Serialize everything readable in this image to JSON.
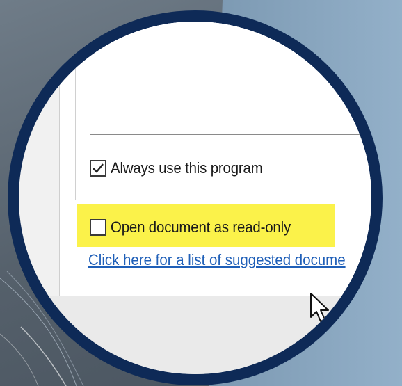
{
  "dialog": {
    "always_use": {
      "label": "Always use this program",
      "checked": true
    },
    "read_only": {
      "label": "Open document as read-only",
      "checked": false
    },
    "suggested_link": "Click here for a list of suggested docume"
  },
  "icons": {
    "check": "checkmark-icon",
    "cursor": "mouse-pointer-icon"
  },
  "colors": {
    "lens_border": "#0e2a57",
    "highlight": "#fbf24a",
    "link": "#1f5fb8"
  }
}
